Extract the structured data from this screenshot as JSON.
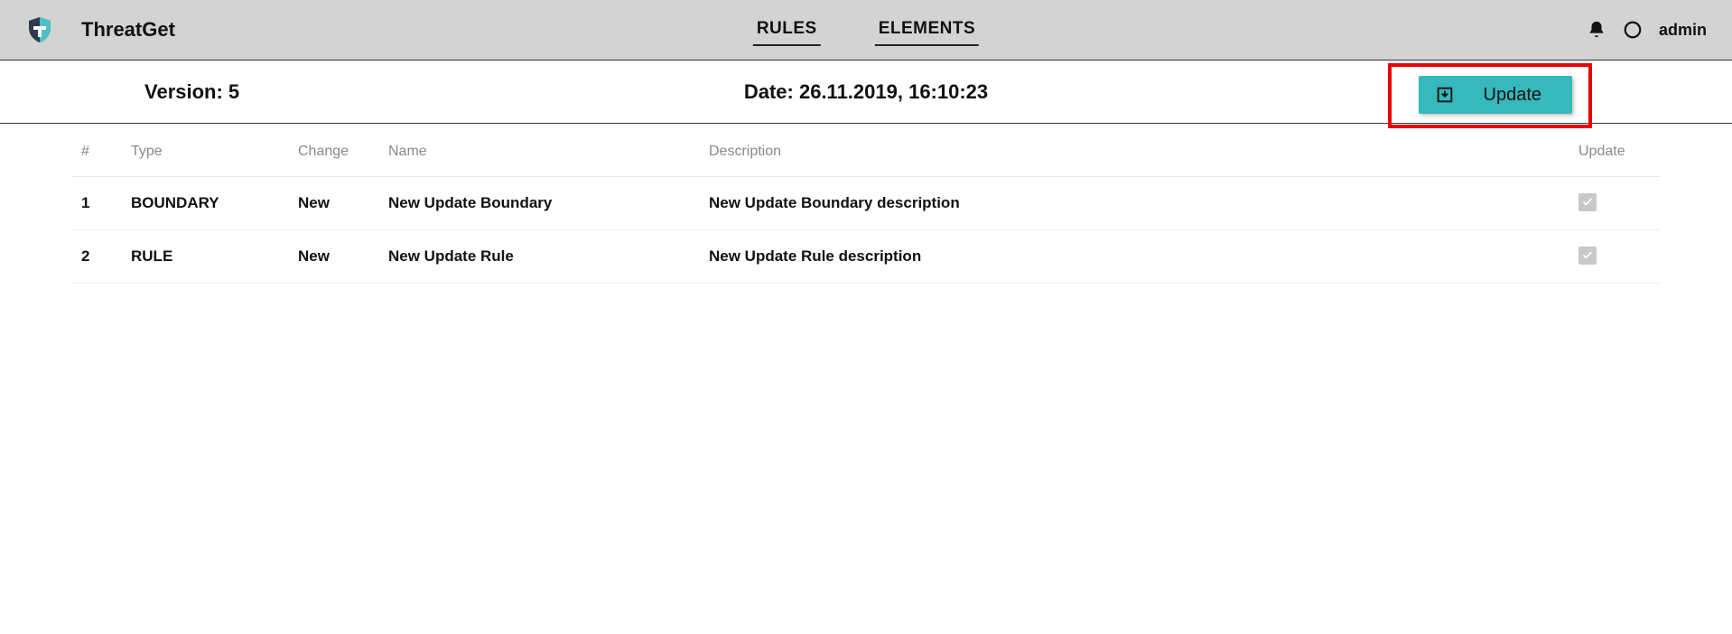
{
  "header": {
    "app_name": "ThreatGet",
    "tabs": {
      "rules": "RULES",
      "elements": "ELEMENTS"
    },
    "username": "admin"
  },
  "infobar": {
    "version_label": "Version: 5",
    "date_label": "Date: 26.11.2019, 16:10:23",
    "update_button": "Update"
  },
  "table": {
    "columns": {
      "num": "#",
      "type": "Type",
      "change": "Change",
      "name": "Name",
      "description": "Description",
      "update": "Update"
    },
    "rows": [
      {
        "num": "1",
        "type": "BOUNDARY",
        "change": "New",
        "name": "New Update Boundary",
        "description": "New Update Boundary description",
        "checked": true
      },
      {
        "num": "2",
        "type": "RULE",
        "change": "New",
        "name": "New Update Rule",
        "description": "New Update Rule description",
        "checked": true
      }
    ]
  }
}
